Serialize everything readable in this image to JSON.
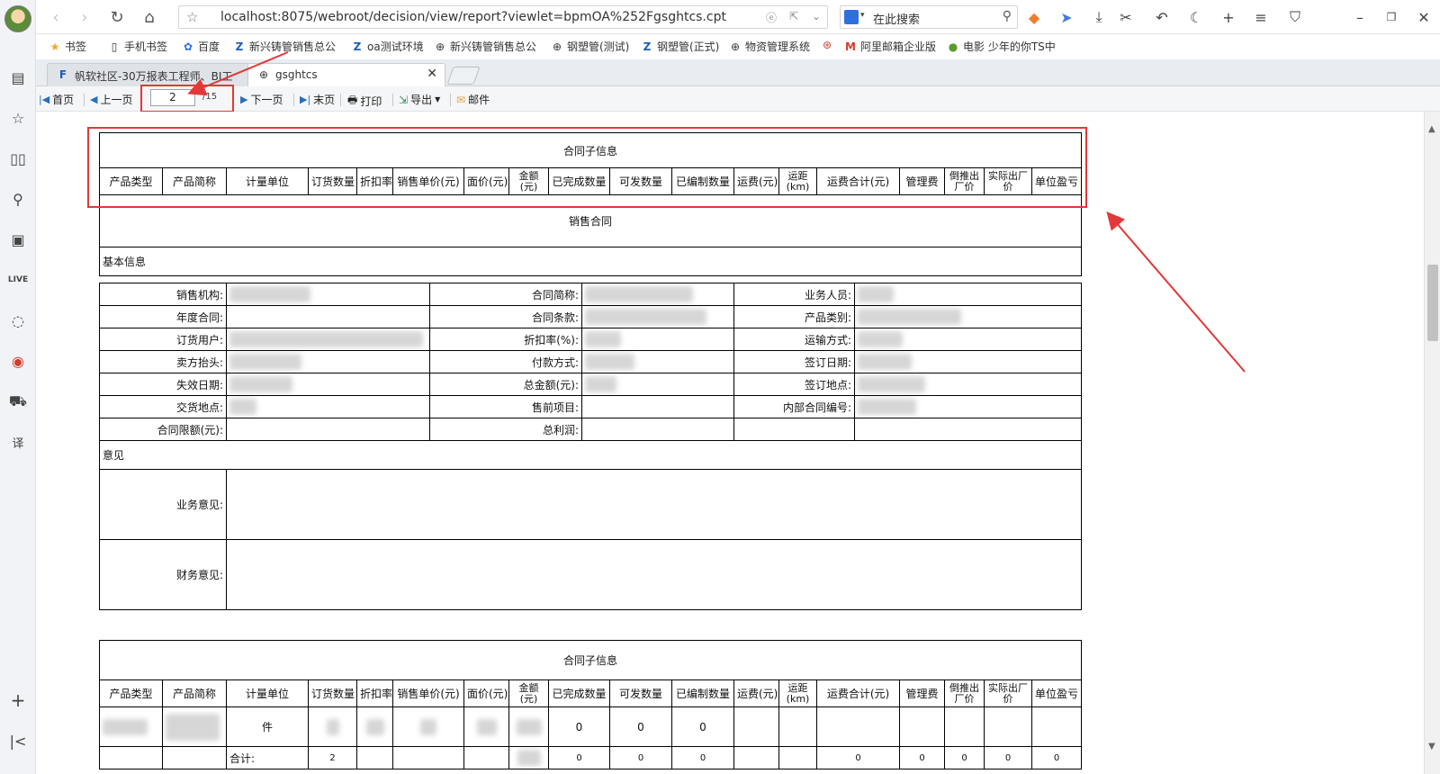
{
  "browser": {
    "url": "localhost:8075/webroot/decision/view/report?viewlet=bpmOA%252Fgsghtcs.cpt",
    "search_placeholder": "在此搜索",
    "bookmarks": [
      "书签",
      "手机书签",
      "百度",
      "新兴铸管销售总公",
      "oa测试环境",
      "新兴铸管销售总公",
      "钢塑管(测试)",
      "钢塑管(正式)",
      "物资管理系统",
      "阿里邮箱企业版",
      "电影 少年的你TS中"
    ],
    "tabs": [
      {
        "label": "帆软社区-30万报表工程师、BI工",
        "active": false
      },
      {
        "label": "gsghtcs",
        "active": true
      }
    ]
  },
  "report_toolbar": {
    "first": "首页",
    "prev": "上一页",
    "page_current": "2",
    "page_total": "/15",
    "next": "下一页",
    "last": "末页",
    "print": "打印",
    "export": "导出",
    "email": "邮件"
  },
  "sub_info": {
    "title": "合同子信息",
    "columns": [
      "产品类型",
      "产品简称",
      "计量单位",
      "订货数量",
      "折扣率",
      "销售单价(元)",
      "面价(元)",
      "金额(元)",
      "已完成数量",
      "可发数量",
      "已编制数量",
      "运费(元)",
      "运距(km)",
      "运费合计(元)",
      "管理费",
      "倒推出厂价",
      "实际出厂价",
      "单位盈亏"
    ]
  },
  "contract": {
    "title": "销售合同",
    "basic_section": "基本信息",
    "rows": [
      [
        "销售机构:",
        "合同简称:",
        "业务人员:"
      ],
      [
        "年度合同:",
        "合同条款:",
        "产品类别:"
      ],
      [
        "订货用户:",
        "折扣率(%):",
        "运输方式:"
      ],
      [
        "卖方抬头:",
        "付款方式:",
        "签订日期:"
      ],
      [
        "失效日期:",
        "总金额(元):",
        "签订地点:"
      ],
      [
        "交货地点:",
        "售前项目:",
        "内部合同编号:"
      ],
      [
        "合同限额(元):",
        "总利润:",
        ""
      ]
    ],
    "opinion_section": "意见",
    "opinions": [
      "业务意见:",
      "财务意见:"
    ]
  },
  "sub_info_2": {
    "title": "合同子信息",
    "row1": {
      "unit": "件",
      "done": "0",
      "available": "0",
      "compiled": "0"
    },
    "total_label": "合计:",
    "total_values": [
      "2",
      "0",
      "0",
      "0",
      "0",
      "0",
      "0",
      "0",
      "0"
    ]
  }
}
